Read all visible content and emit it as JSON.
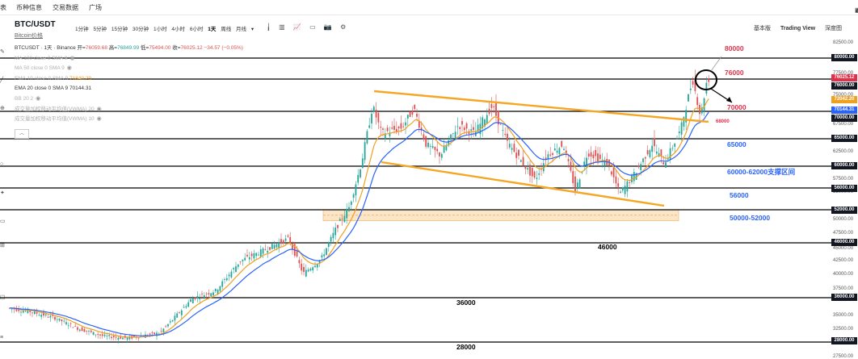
{
  "topnav": {
    "items": [
      "表",
      "币种信息",
      "交易数据",
      "广场"
    ]
  },
  "corner_icons": [
    "↙",
    "▦"
  ],
  "header": {
    "symbol": "BTC/USDT",
    "subtitle": "Bitcoin价格",
    "timeframes": [
      "1分钟",
      "5分钟",
      "15分钟",
      "30分钟",
      "1小时",
      "4小时",
      "6小时",
      "1天",
      "周线",
      "月线",
      "▾"
    ],
    "active_timeframe": "1天",
    "right_tabs": [
      "基本版",
      "Trading View",
      "深度图"
    ],
    "active_tab": "Trading View"
  },
  "legend": {
    "title": "BTCUSDT · 1天 · Binance",
    "open_label": "开=",
    "open": "76059.68",
    "high_label": "高=",
    "high": "76849.99",
    "low_label": "低=",
    "low": "75494.00",
    "close_label": "收=",
    "close": "76025.12",
    "change": "−34.57 (−0.05%)",
    "ma_lines": [
      {
        "text": "MA 100 close 0 SMA 9",
        "value": "",
        "style": "faint"
      },
      {
        "text": "MA 50 close 0 SMA 9",
        "value": "",
        "style": "faint"
      },
      {
        "text": "EMA 10 close 0 SMA 9",
        "value": "71840.29",
        "style": "ema10"
      },
      {
        "text": "EMA 20 close 0 SMA 9",
        "value": "70144.31",
        "style": "ema20"
      },
      {
        "text": "BB 20 2",
        "value": "",
        "style": "faint"
      },
      {
        "text": "成交量加权移动平均值(VWMA) 20",
        "value": "",
        "style": "faint"
      },
      {
        "text": "成交量加权移动平均值(VWMA) 10",
        "value": "",
        "style": "faint"
      }
    ],
    "collapse_icon": "︿"
  },
  "left_rail_icons": [
    "✎",
    "╱",
    "⊕",
    "○",
    "✦",
    "▭",
    "⊞",
    "☐",
    "≡"
  ],
  "toolbar_icons": [
    "╽",
    "▥",
    "📈",
    "▭",
    "📷",
    "⚙"
  ],
  "price_axis": {
    "ticks": [
      "82500.00",
      "77500.00",
      "75000.00",
      "67500.00",
      "62500.00",
      "57500.00",
      "55000.00",
      "50000.00",
      "47500.00",
      "45000.00",
      "42500.00",
      "40000.00",
      "37500.00",
      "35000.00",
      "32500.00",
      "30000.00",
      "27500.00"
    ],
    "tags": [
      {
        "label": "80000.00",
        "bg": "#131722",
        "fg": "#ffffff"
      },
      {
        "label": "76025.12",
        "bg": "#e0304a",
        "fg": "#ffffff"
      },
      {
        "label": "76000.00",
        "bg": "#131722",
        "fg": "#ffffff"
      },
      {
        "label": "72042.20",
        "bg": "#f0a020",
        "fg": "#ffffff"
      },
      {
        "label": "70144.31",
        "bg": "#2962ff",
        "fg": "#ffffff"
      },
      {
        "label": "70000.00",
        "bg": "#131722",
        "fg": "#ffffff"
      },
      {
        "label": "65000.00",
        "bg": "#131722",
        "fg": "#ffffff"
      },
      {
        "label": "60000.00",
        "bg": "#131722",
        "fg": "#ffffff"
      },
      {
        "label": "56000.00",
        "bg": "#131722",
        "fg": "#ffffff"
      },
      {
        "label": "52000.00",
        "bg": "#131722",
        "fg": "#ffffff"
      },
      {
        "label": "46000.00",
        "bg": "#131722",
        "fg": "#ffffff"
      },
      {
        "label": "36000.00",
        "bg": "#131722",
        "fg": "#ffffff"
      },
      {
        "label": "28000.00",
        "bg": "#131722",
        "fg": "#ffffff"
      }
    ]
  },
  "annotations": {
    "r80000": "80000",
    "r76000": "76000",
    "r70000": "70000",
    "r68000": "68000",
    "b65000": "65000",
    "b60000": "60000-62000支撑区间",
    "b56000": "56000",
    "b50000": "50000-52000",
    "k46000": "46000",
    "k36000": "36000",
    "k28000": "28000"
  },
  "colors": {
    "horizontal_line": "#000000",
    "trend_channel": "#f5a623",
    "ema_fast": "#f0a020",
    "ema_slow": "#2962ff",
    "candle_up": "#26a69a",
    "candle_down": "#e05050",
    "support_zone": "#fce6c8"
  }
}
